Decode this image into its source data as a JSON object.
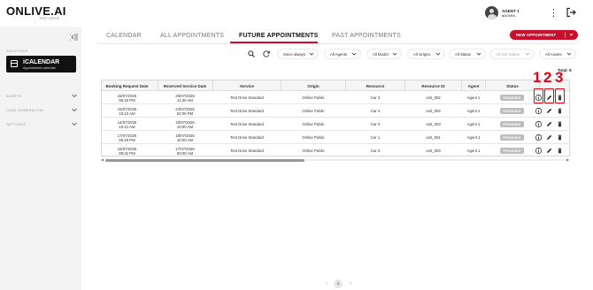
{
  "header": {
    "logo": "ONLIVE.AI",
    "logo_sub": "TEST DRIVE",
    "user_name": "AGENT 1",
    "user_role": "ADMIN",
    "menu_icon": "kebab-menu-icon",
    "logout_icon": "logout-icon"
  },
  "sidebar": {
    "section_label": "SOLUTIONS",
    "calendar_card": {
      "title": "iCALENDAR",
      "subtitle": "Appointment calendar",
      "icon": "calendar-icon"
    },
    "items": [
      {
        "label": "ASSETS"
      },
      {
        "label": "LEAD GENERATION"
      },
      {
        "label": "SETTINGS"
      }
    ]
  },
  "tabs": [
    {
      "label": "CALENDAR",
      "active": false
    },
    {
      "label": "ALL APPOINTMENTS",
      "active": false
    },
    {
      "label": "FUTURE APPOINTMENTS",
      "active": true
    },
    {
      "label": "PAST APPOINTMENTS",
      "active": false
    }
  ],
  "new_appointment_label": "NEW APPOINTMENT",
  "filters": [
    {
      "label": "Since always"
    },
    {
      "label": "All Agents"
    },
    {
      "label": "All Model"
    },
    {
      "label": "All Origins"
    },
    {
      "label": "All Status"
    },
    {
      "label": "All Sub Status",
      "disabled": true
    },
    {
      "label": "All Assets"
    }
  ],
  "total_label": "Total: 5",
  "table": {
    "columns": [
      "Booking Request Date",
      "Reserved Service Date",
      "Service",
      "Origin",
      "Resource",
      "Resource ID",
      "Agent",
      "Status"
    ],
    "rows": [
      {
        "booking": [
          "15/07/2025",
          "08:28 PM"
        ],
        "reserved": [
          "25/07/2025",
          "11:30 AM"
        ],
        "service": "Test Drive Standard",
        "origin": "Online Public",
        "resource": "Car 3",
        "resource_id": "unit_002",
        "agent": "Agent 1",
        "status": "PENDING"
      },
      {
        "booking": [
          "15/07/2025",
          "10:23 AM"
        ],
        "reserved": [
          "23/07/2025",
          "02:00 PM"
        ],
        "service": "Test Drive Standard",
        "origin": "Online Public",
        "resource": "Car 4",
        "resource_id": "unit_004",
        "agent": "Agent 1",
        "status": "PENDING"
      },
      {
        "booking": [
          "14/07/2025",
          "10:21 AM"
        ],
        "reserved": [
          "18/07/2025",
          "10:00 AM"
        ],
        "service": "Test Drive Standard",
        "origin": "Online Public",
        "resource": "Car 3",
        "resource_id": "unit_003",
        "agent": "Agent 1",
        "status": "PENDING"
      },
      {
        "booking": [
          "17/07/2025",
          "06:49 PM"
        ],
        "reserved": [
          "18/07/2025",
          "10:00 AM"
        ],
        "service": "Test Drive Standard",
        "origin": "Online Public",
        "resource": "Car 1",
        "resource_id": "unit_001",
        "agent": "Agent 1",
        "status": "PENDING"
      },
      {
        "booking": [
          "15/07/2025",
          "08:32 PM"
        ],
        "reserved": [
          "17/07/2025",
          "09:00 AM"
        ],
        "service": "Test Drive Standard",
        "origin": "Online Public",
        "resource": "Car 3",
        "resource_id": "unit_003",
        "agent": "Agent 1",
        "status": "PENDING"
      }
    ]
  },
  "annotations": [
    "1",
    "2",
    "3"
  ],
  "pagination": {
    "current": "1"
  },
  "colors": {
    "accent": "#c8102e",
    "annotation": "#e0001a",
    "badge": "#bdbdbd"
  }
}
